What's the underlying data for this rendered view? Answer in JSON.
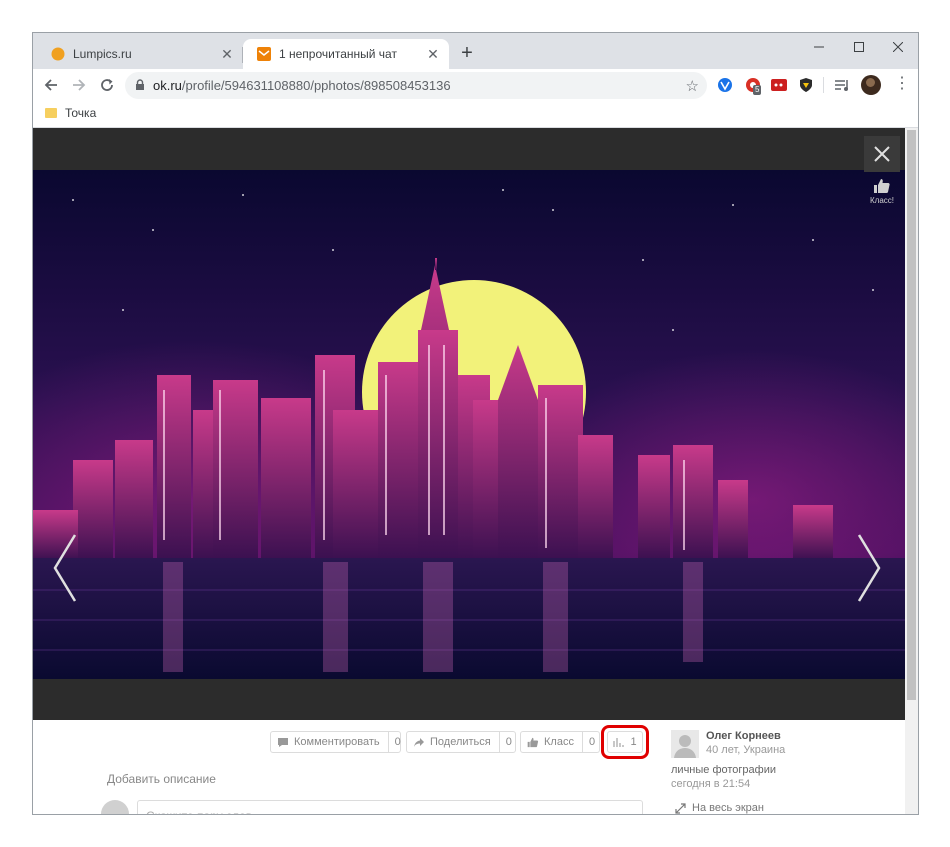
{
  "browser": {
    "tabs": [
      {
        "title": "Lumpics.ru",
        "active": false
      },
      {
        "title": "1 непрочитанный чат",
        "active": true
      }
    ],
    "new_tab_label": "+",
    "url_host": "ok.ru",
    "url_path": "/profile/594631108880/pphotos/898508453136",
    "extension_badge": "5",
    "bookmarks": [
      {
        "label": "Точка"
      }
    ]
  },
  "viewer": {
    "klass_label": "Класс!"
  },
  "actions": {
    "comment_label": "Комментировать",
    "comment_count": "0",
    "share_label": "Поделиться",
    "share_count": "0",
    "klass_label": "Класс",
    "klass_count": "0",
    "stats_count": "1"
  },
  "photo_info": {
    "add_description": "Добавить описание",
    "comment_placeholder": "Скажите пару слов...",
    "owner_name": "Олег Корнеев",
    "owner_meta": "40 лет, Украина",
    "album": "личные фотографии",
    "time": "сегодня в 21:54",
    "fullscreen_label": "На весь экран"
  },
  "colors": {
    "accent_orange": "#ee8208",
    "highlight_red": "#e00000",
    "moon_yellow": "#f2f27a"
  }
}
